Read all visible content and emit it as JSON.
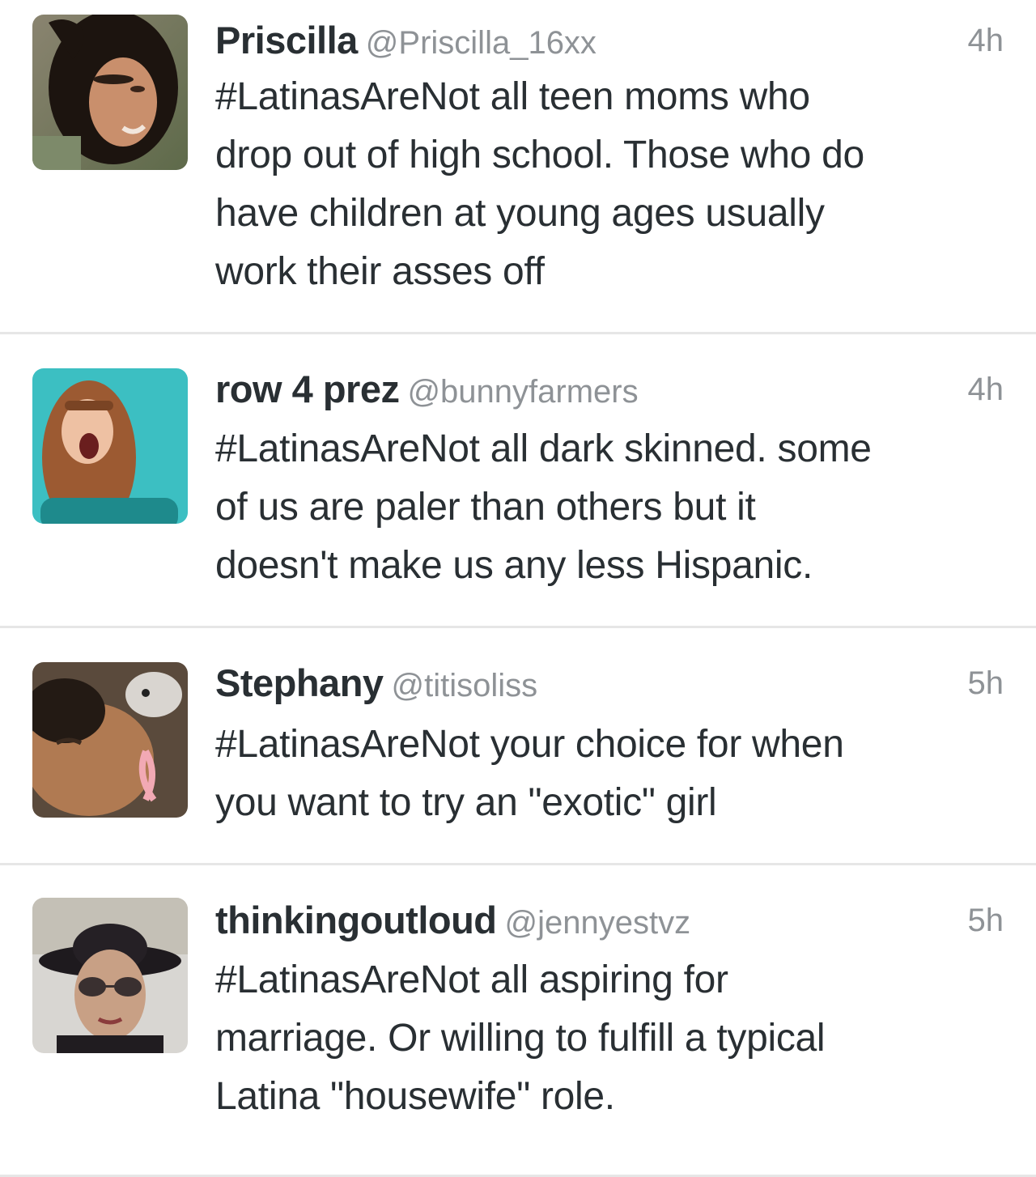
{
  "tweets": [
    {
      "name": "Priscilla",
      "handle": "@Priscilla_16xx",
      "time": "4h",
      "avatar_icon": "profile-photo-curly-hair",
      "lines": [
        "#LatinasAreNot all teen moms who",
        "drop out of high school. Those who do",
        "have children at young ages usually",
        "work their asses off"
      ]
    },
    {
      "name": "row 4 prez",
      "handle": "@bunnyfarmers",
      "time": "4h",
      "avatar_icon": "profile-photo-teal-background",
      "lines": [
        "#LatinasAreNot all dark skinned. some",
        "of us are paler than others but it",
        "doesn't make us any less Hispanic."
      ]
    },
    {
      "name": "Stephany",
      "handle": "@titisoliss",
      "time": "5h",
      "avatar_icon": "profile-photo-pink-ribbon",
      "lines": [
        "#LatinasAreNot your choice for when",
        "you want to try an \"exotic\" girl"
      ]
    },
    {
      "name": "thinkingoutloud",
      "handle": "@jennyestvz",
      "time": "5h",
      "avatar_icon": "profile-photo-hat-sunglasses",
      "lines": [
        "#LatinasAreNot all aspiring for",
        "marriage. Or willing to fulfill a typical",
        "Latina \"housewife\" role."
      ]
    }
  ],
  "colors": {
    "name": "#292f33",
    "meta": "#8e9296",
    "divider": "#e6e6e6",
    "background": "#ffffff"
  }
}
